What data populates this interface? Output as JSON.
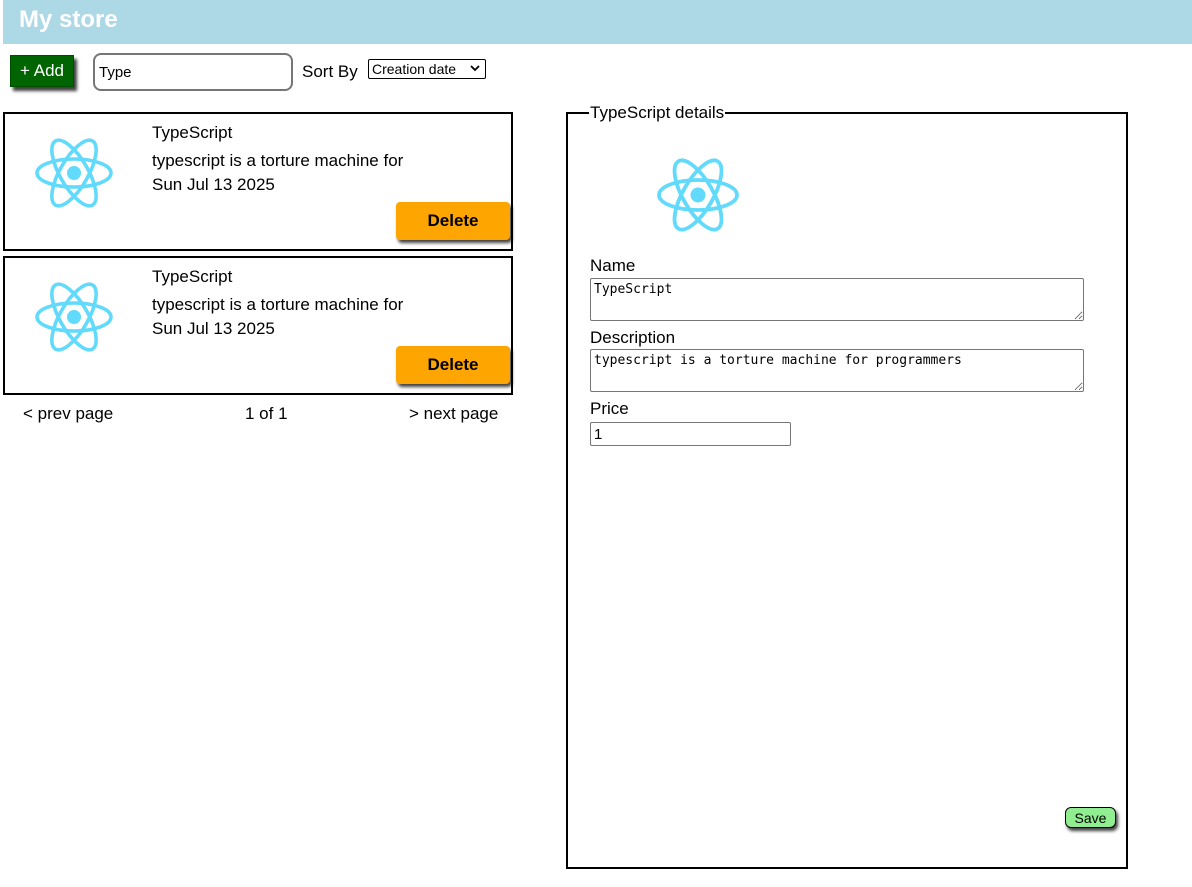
{
  "header": {
    "title": "My store"
  },
  "toolbar": {
    "add_label": "+ Add",
    "search_value": "Type",
    "sort_label": "Sort By",
    "sort_selected": "Creation date"
  },
  "products": [
    {
      "name": "TypeScript",
      "description": "typescript is a torture machine for",
      "date": "Sun Jul 13 2025",
      "delete_label": "Delete"
    },
    {
      "name": "TypeScript",
      "description": "typescript is a torture machine for",
      "date": "Sun Jul 13 2025",
      "delete_label": "Delete"
    }
  ],
  "pagination": {
    "prev_label": "< prev page",
    "status": "1 of 1",
    "next_label": "> next page"
  },
  "details": {
    "legend": "TypeScript details",
    "name_label": "Name",
    "name_value": "TypeScript",
    "description_label": "Description",
    "description_value": "typescript is a torture machine for programmers",
    "price_label": "Price",
    "price_value": "1",
    "save_label": "Save"
  },
  "colors": {
    "header_bg": "#add8e6",
    "add_button": "#006400",
    "delete_button": "#ffa500",
    "save_button": "#90ee90",
    "react_logo": "#61dafb"
  },
  "icons": {
    "product_image": "react-logo-icon",
    "sort_dropdown": "chevron-down-icon"
  }
}
